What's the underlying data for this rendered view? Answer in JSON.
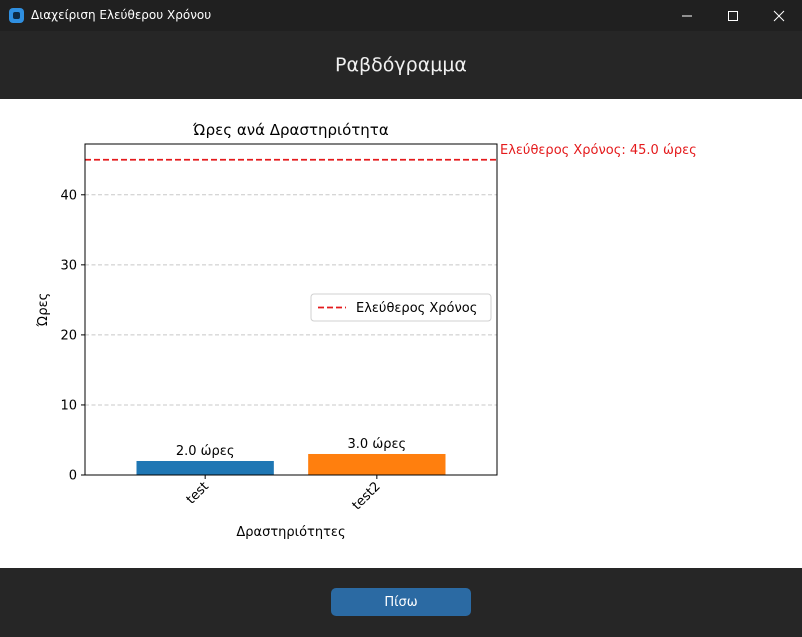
{
  "window": {
    "title": "Διαχείριση Ελεύθερου Χρόνου"
  },
  "header": {
    "title": "Ραβδόγραμμα"
  },
  "footer": {
    "back_label": "Πίσω"
  },
  "colors": {
    "bar_series": [
      "#1f77b4",
      "#ff7f0e"
    ],
    "reference_line": "#e41a1c",
    "back_button": "#2b6aa3"
  },
  "chart_data": {
    "type": "bar",
    "title": "Ώρες ανά Δραστηριότητα",
    "xlabel": "Δραστηριότητες",
    "ylabel": "Ώρες",
    "categories": [
      "test",
      "test2"
    ],
    "values": [
      2.0,
      3.0
    ],
    "bar_labels": [
      "2.0 ώρες",
      "3.0 ώρες"
    ],
    "ylim": [
      0,
      47.25
    ],
    "yticks": [
      0,
      10,
      20,
      30,
      40
    ],
    "ytick_labels": [
      "0",
      "10",
      "20",
      "30",
      "40"
    ],
    "grid": "y-dashed",
    "reference_line": {
      "value": 45.0,
      "style": "dashed",
      "legend_label": "Ελεύθερος Χρόνος",
      "annotation": "Ελεύθερος Χρόνος: 45.0 ώρες"
    },
    "legend_position": "center-right"
  }
}
